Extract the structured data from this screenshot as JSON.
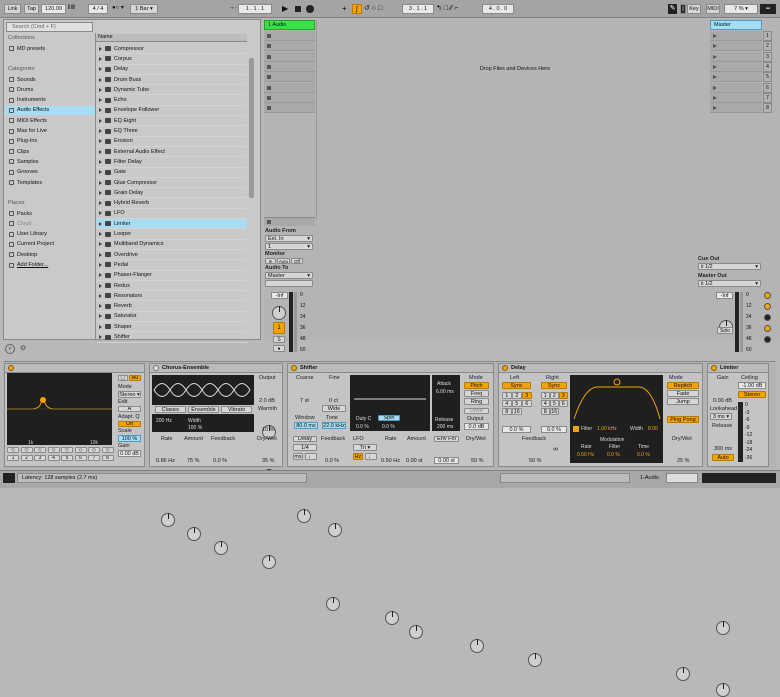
{
  "transport": {
    "link": "Link",
    "tap": "Tap",
    "tempo": "120.00",
    "meter": "4 / 4",
    "metro": "1 Bar",
    "position": "1 . 1 . 1",
    "loop_start": "3 . 1 . 1",
    "loop_len": "4 . 0 . 0",
    "key": "Key",
    "midi": "MIDI",
    "cpu": "7 %"
  },
  "browser": {
    "search_placeholder": "Search (Cmd + F)",
    "collections_h": "Collections",
    "collection_item": "MD presets",
    "categories_h": "Categories",
    "categories": [
      "Sounds",
      "Drums",
      "Instruments",
      "Audio Effects",
      "MIDI Effects",
      "Max for Live",
      "Plug-Ins",
      "Clips",
      "Samples",
      "Grooves",
      "Templates"
    ],
    "places_h": "Places",
    "places": [
      "Packs",
      "Cloud",
      "User Library",
      "Current Project",
      "Desktop",
      "Add Folder..."
    ],
    "list_header": "Name",
    "items": [
      "Compressor",
      "Corpus",
      "Delay",
      "Drum Buss",
      "Dynamic Tube",
      "Echo",
      "Envelope Follower",
      "EQ Eight",
      "EQ Three",
      "Erosion",
      "External Audio Effect",
      "Filter Delay",
      "Gate",
      "Glue Compressor",
      "Grain Delay",
      "Hybrid Reverb",
      "LFO",
      "Limiter",
      "Looper",
      "Multiband Dynamics",
      "Overdrive",
      "Pedal",
      "Phaser-Flanger",
      "Redux",
      "Resonators",
      "Reverb",
      "Saturator",
      "Shaper",
      "Shifter"
    ]
  },
  "session": {
    "track_name": "1 Audio",
    "master_name": "Master",
    "drop_text": "Drop Files and Devices Here",
    "scenes": [
      "1",
      "2",
      "3",
      "4",
      "5",
      "6",
      "7",
      "8"
    ],
    "audio_from": "Audio From",
    "ext_in": "Ext. In",
    "input_ch": "1",
    "monitor": "Monitor",
    "mon_in": "In",
    "mon_auto": "Auto",
    "mon_off": "Off",
    "audio_to": "Audio To",
    "audio_to_val": "Master",
    "cue_out": "Cue Out",
    "cue_val": "ii 1/2",
    "master_out": "Master Out",
    "master_val": "ii 1/2",
    "vol": "-Inf",
    "mvol": "-Inf",
    "track_num": "1",
    "solo": "S",
    "arm": "●",
    "msolo": "Solo",
    "meter_ticks": [
      "0",
      "12",
      "24",
      "36",
      "48",
      "60"
    ]
  },
  "eq": {
    "title": "EQ Eight",
    "adapt_label": "Adapt. Q",
    "adapt": "On",
    "scale_label": "Scale",
    "scale": "100 %",
    "mode_label": "Mode",
    "mode": "Stereo",
    "edit_label": "Edit",
    "edit": "A",
    "gain_label": "Gain",
    "gain": "0.00 dB",
    "freq1": "1k",
    "freq2": "10k",
    "bands": [
      "1",
      "2",
      "3",
      "4",
      "5",
      "6",
      "7",
      "8"
    ]
  },
  "chorus": {
    "title": "Chorus-Ensemble",
    "modes": [
      "Classic",
      "Ensemble",
      "Vibrato"
    ],
    "lfo_hz": "200 Hz",
    "width_label": "Width",
    "width": "100 %",
    "output_label": "Output",
    "output": "2.0 dB",
    "warmth_label": "Warmth",
    "warmth": "10 %",
    "rate_label": "Rate",
    "rate": "0.86 Hz",
    "amount_label": "Amount",
    "amount": "75 %",
    "feedback_label": "Feedback",
    "feedback": "0.0 %",
    "drywet_label": "Dry/Wet",
    "drywet": "35 %"
  },
  "shifter": {
    "title": "Shifter",
    "coarse_label": "Coarse",
    "coarse": "7 st",
    "fine_label": "Fine",
    "fine": "0 ct",
    "wide": "Wide",
    "window_label": "Window",
    "window": "80.0 ms",
    "tone_label": "Tone",
    "tone": "22.0 kHz",
    "duty_label": "Duty C",
    "spin_label": "Spin",
    "duty": "0.0 %",
    "spin": "0.0 %",
    "attack_label": "Attack",
    "attack": "6.00 ms",
    "release_label": "Release",
    "release": "200 ms",
    "mode_label": "Mode",
    "modes": [
      "Pitch",
      "Freq",
      "Ring"
    ],
    "drive": "Drive",
    "output_label": "Output",
    "output": "0.0 dB",
    "delay_label": "Delay",
    "delay_val": "1/4",
    "feedback_label": "Feedback",
    "feedback": "0.0 %",
    "lfo_label": "LFO",
    "lfo_shape": "Tri",
    "rate_label": "Rate",
    "rate": "0.50 Hz",
    "amount_label": "Amount",
    "amount": "0.00 st",
    "envfol": "Env Fol",
    "envamt": "0.00 st",
    "drywet_label": "Dry/Wet",
    "drywet": "50 %",
    "hz": "Hz",
    "ms": "ms"
  },
  "delay": {
    "title": "Delay",
    "left_label": "Left",
    "right_label": "Right",
    "sync": "Sync",
    "nums": [
      "1",
      "2",
      "3",
      "4",
      "5",
      "6",
      "8",
      "16"
    ],
    "left_off": "0.0 %",
    "right_off": "0.0 %",
    "feedback_label": "Feedback",
    "feedback": "50 %",
    "filter": "Filter",
    "filter_freq": "1.00 kHz",
    "width_label": "Width",
    "width": "8.00",
    "mod_label": "Modulation",
    "rate_label": "Rate",
    "rate": "0.50 Hz",
    "filt_label": "Filter",
    "filt": "0.0 %",
    "time_label": "Time",
    "time": "0.0 %",
    "mode_label": "Mode",
    "modes": [
      "Repitch",
      "Fade",
      "Jump"
    ],
    "pingpong": "Ping Pong",
    "drywet_label": "Dry/Wet",
    "drywet": "25 %"
  },
  "limiter": {
    "title": "Limiter",
    "gain_label": "Gain",
    "gain": "0.00 dB",
    "ceiling_label": "Ceiling",
    "ceiling": "-1.00 dB",
    "stereo": "Stereo",
    "lookahead_label": "Lookahead",
    "lookahead": "3 ms",
    "release_label": "Release",
    "release": "300 ms",
    "auto": "Auto",
    "ticks": [
      "0",
      "-3",
      "-6",
      "-9",
      "-12",
      "-18",
      "-24",
      "-36"
    ]
  },
  "status": {
    "latency": "Latency: 128 samples (2.7 ms)",
    "track": "1-Audio"
  }
}
